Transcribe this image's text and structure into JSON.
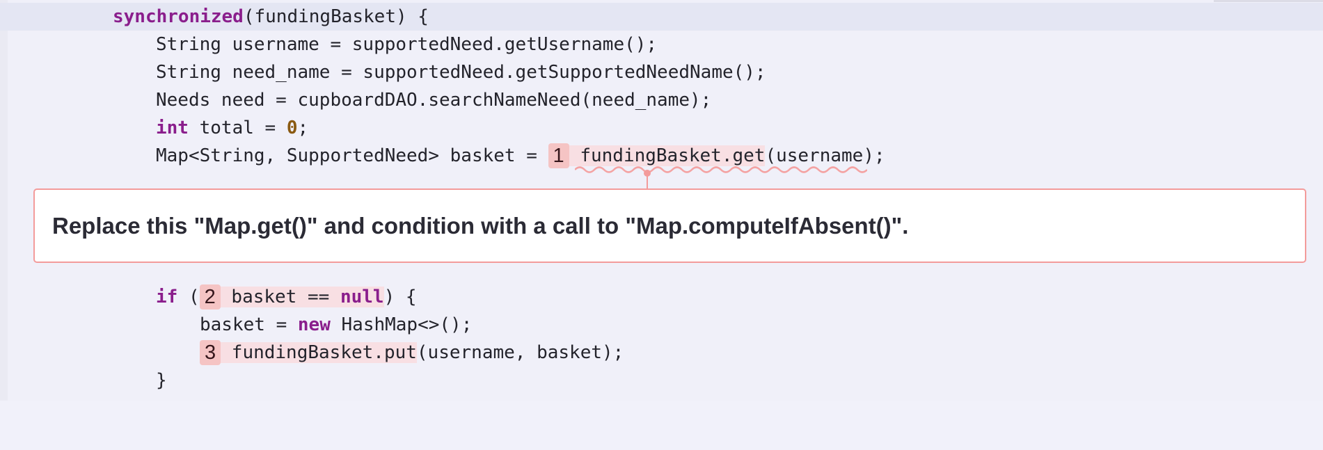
{
  "code": {
    "line1": {
      "kw": "synchronized",
      "rest": "(fundingBasket) {"
    },
    "line2": "String username = supportedNeed.getUsername();",
    "line3": "String need_name = supportedNeed.getSupportedNeedName();",
    "line4": "Needs need = cupboardDAO.searchNameNeed(need_name);",
    "line5": {
      "kw": "int",
      "mid": " total = ",
      "num": "0",
      "end": ";"
    },
    "line6": {
      "pre": "Map<String, SupportedNeed> basket = ",
      "marker": "1",
      "call": "fundingBasket.get",
      "args": "(username);"
    },
    "line7": {
      "kw": "if",
      "open": " (",
      "marker": "2",
      "expr": " basket == ",
      "null": "null",
      "close": ") {"
    },
    "line8": {
      "pre": "basket = ",
      "kw": "new",
      "post": " HashMap<>();"
    },
    "line9": {
      "marker": "3",
      "call": " fundingBasket.put",
      "args": "(username, basket);"
    },
    "line10": "}"
  },
  "issue": {
    "message": "Replace this \"Map.get()\" and condition with a call to \"Map.computeIfAbsent()\"."
  },
  "colors": {
    "background": "#f0f0f9",
    "keyword": "#8a1e8c",
    "marker": "#f5c4c4",
    "highlight": "#f8dfe3",
    "issue_border": "#f39b9b"
  }
}
